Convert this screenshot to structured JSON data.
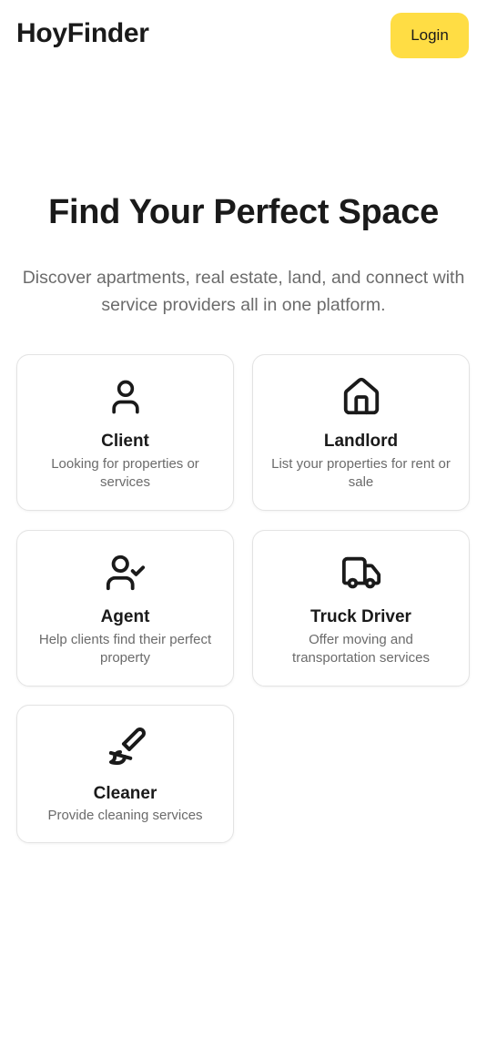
{
  "header": {
    "logo": "HoyFinder",
    "login_label": "Login"
  },
  "hero": {
    "title": "Find Your Perfect Space",
    "subtitle": "Discover apartments, real estate, land, and connect with service providers all in one platform."
  },
  "roles": [
    {
      "icon": "user-icon",
      "title": "Client",
      "description": "Looking for properties or services"
    },
    {
      "icon": "home-icon",
      "title": "Landlord",
      "description": "List your properties for rent or sale"
    },
    {
      "icon": "user-check-icon",
      "title": "Agent",
      "description": "Help clients find their perfect property"
    },
    {
      "icon": "truck-icon",
      "title": "Truck Driver",
      "description": "Offer moving and transportation services"
    },
    {
      "icon": "paintbrush-icon",
      "title": "Cleaner",
      "description": "Provide cleaning services"
    }
  ],
  "colors": {
    "accent": "#ffdd44",
    "text": "#1a1a1a",
    "muted": "#6b6b6b",
    "card_border": "#e3e3e3"
  }
}
